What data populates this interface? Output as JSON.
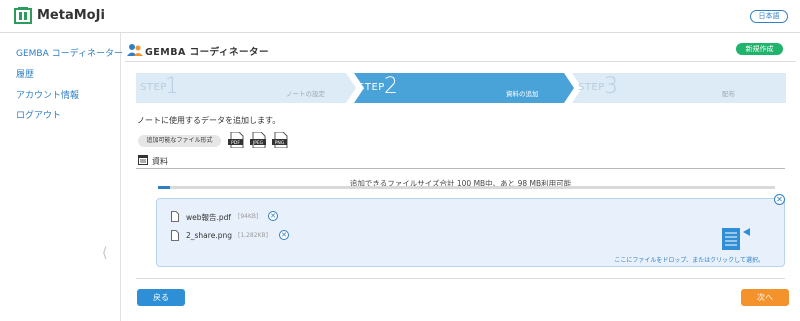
{
  "header": {
    "logo_text": "MetaMoJi",
    "language_label": "日本語"
  },
  "sidebar": {
    "items": [
      {
        "label": "GEMBA コーディネーター"
      },
      {
        "label": "履歴"
      },
      {
        "label": "アカウント情報"
      },
      {
        "label": "ログアウト"
      }
    ],
    "collapse_glyph": "⟨"
  },
  "main": {
    "title": "GEMBA コーディネーター",
    "new_button": "新規作成",
    "steps": [
      {
        "prefix": "STEP",
        "number": "1",
        "label": "ノートの設定",
        "state": "done"
      },
      {
        "prefix": "STEP",
        "number": "2",
        "label": "資料の追加",
        "state": "active"
      },
      {
        "prefix": "STEP",
        "number": "3",
        "label": "配布",
        "state": "pending"
      }
    ],
    "instruction": "ノートに使用するデータを追加します。",
    "format_button": "追加可能なファイル形式",
    "file_types": [
      "PDF",
      "JPEG",
      "PNG"
    ],
    "materials_label": "資料",
    "quota_text": "追加できるファイルサイズ合計 100 MB中、あと 98 MB利用可能",
    "quota_used_fraction": 0.02,
    "files": [
      {
        "name": "web報告.pdf",
        "size": "[94KB]"
      },
      {
        "name": "2_share.png",
        "size": "[1,282KB]"
      }
    ],
    "drop_hint": "ここにファイルをドロップ、またはクリックして選択。",
    "back_button": "戻る",
    "next_button": "次へ"
  },
  "colors": {
    "accent_blue": "#2f7fc4",
    "step_active": "#4aa3d8",
    "step_inactive": "#dcebf6",
    "new_green": "#1fb36b",
    "next_orange": "#f4922b"
  }
}
